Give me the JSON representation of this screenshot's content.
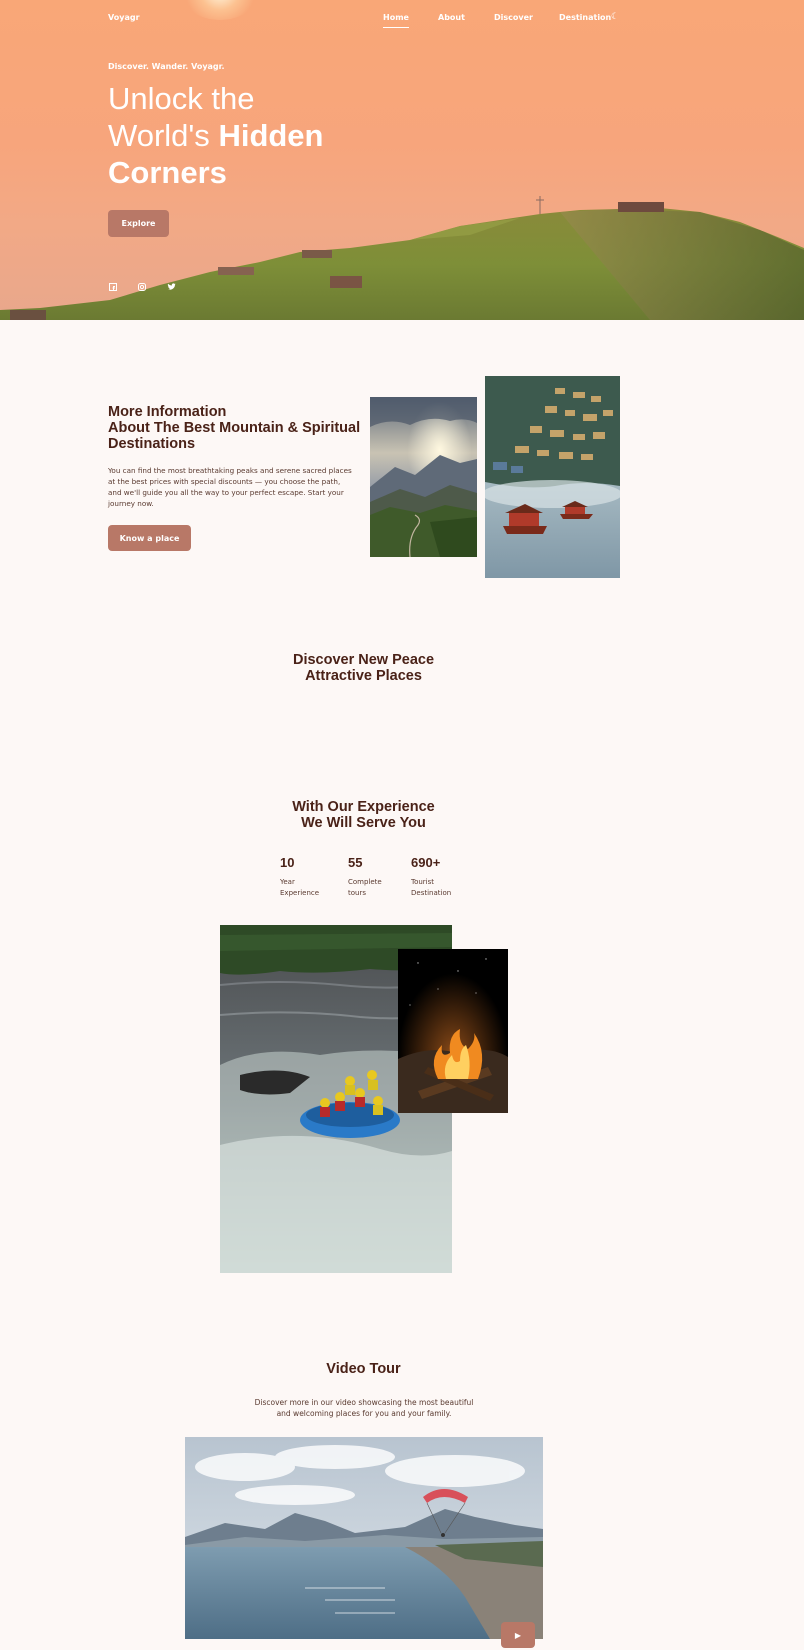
{
  "brand": "Voyagr",
  "nav": {
    "items": [
      "Home",
      "About",
      "Discover",
      "Destination"
    ],
    "active": "Home",
    "theme_icon": "moon-icon"
  },
  "hero": {
    "tagline": "Discover. Wander. Voyagr.",
    "title_line1": "Unlock the",
    "title_line2_plain": "World's ",
    "title_line2_bold": "Hidden",
    "title_line3_bold": "Corners",
    "explore_label": "Explore",
    "social_icons": [
      "facebook-icon",
      "instagram-icon",
      "twitter-icon"
    ]
  },
  "info": {
    "title_line1": "More Information",
    "title_line2": "About The Best Mountain & Spiritual",
    "title_line3": "Destinations",
    "text": "You can find the most breathtaking peaks and serene sacred places at the best prices with special discounts — you choose the path, and we'll guide you all the way to your perfect escape. Start your journey now.",
    "button_label": "Know a place"
  },
  "discover": {
    "title_line1": "Discover New Peace",
    "title_line2": "Attractive Places"
  },
  "experience": {
    "title_line1": "With Our Experience",
    "title_line2": "We Will Serve You",
    "stats": [
      {
        "value": "10",
        "label_line1": "Year",
        "label_line2": "Experience"
      },
      {
        "value": "55",
        "label_line1": "Complete",
        "label_line2": "tours"
      },
      {
        "value": "690+",
        "label_line1": "Tourist",
        "label_line2": "Destination"
      }
    ]
  },
  "video": {
    "title": "Video Tour",
    "text_line1": "Discover more in our video showcasing the most beautiful",
    "text_line2": "and welcoming places for you and your family.",
    "play_icon": "play-icon"
  },
  "colors": {
    "accent": "#b87867",
    "heading": "#4a2218",
    "background": "#fdf8f6",
    "hero_top": "#f9a777"
  }
}
